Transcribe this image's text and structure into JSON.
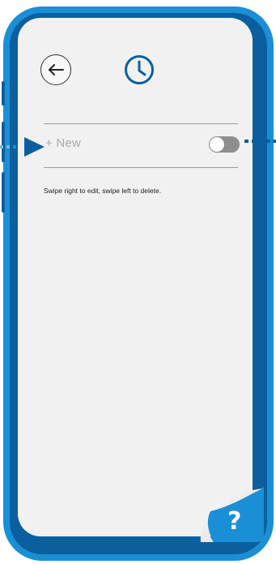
{
  "colors": {
    "frame_outer": "#1a8fd6",
    "frame_inner": "#0b5f9e",
    "screen_bg": "#f1f1f1",
    "accent": "#0b5f9e",
    "toggle_off": "#8e8e8e",
    "muted_text": "#a9a9a9"
  },
  "header": {
    "back_icon": "arrow-left-icon",
    "history_icon": "clock-icon"
  },
  "list": {
    "new_item_label": "+ New",
    "toggle_state": "off"
  },
  "hint_text": "Swipe right to edit, swipe left to delete.",
  "help": {
    "glyph": "?"
  }
}
